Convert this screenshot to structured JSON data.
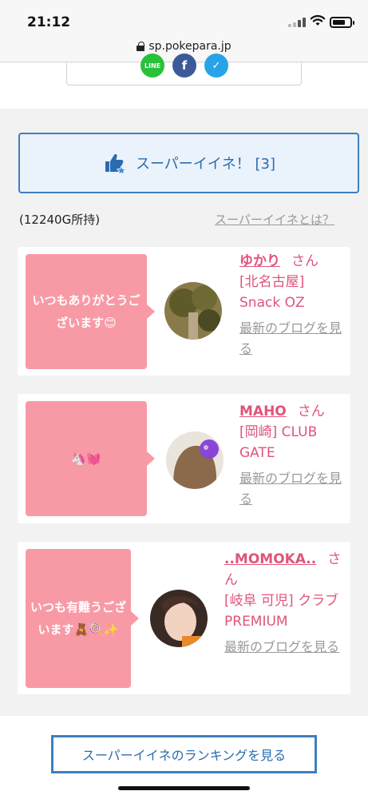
{
  "status": {
    "time": "21:12"
  },
  "browser": {
    "url": "sp.pokepara.jp"
  },
  "share": {
    "line_label": "LINE",
    "facebook_glyph": "f",
    "twitter_glyph": "✓"
  },
  "super_button": {
    "label": "スーパーイイネ！ [3]"
  },
  "gold": {
    "text": "(12240G所持)"
  },
  "what_link": {
    "text": "スーパーイイネとは？"
  },
  "cards": [
    {
      "message": "いつもありがとうございます😊",
      "name": "ゆかり",
      "suffix": "さん",
      "shop": "[北名古屋] Snack OZ",
      "blog": "最新のブログを見る"
    },
    {
      "message": "🦄💓",
      "name": "MAHO",
      "suffix": "さん",
      "shop": "[岡崎] CLUB GATE",
      "blog": "最新のブログを見る"
    },
    {
      "message": "いつも有難うございます🧸🍭✨",
      "name": "..MOMOKA..",
      "suffix": "さん",
      "shop": "[岐阜 可児] クラブ PREMIUM",
      "blog": "最新のブログを見る"
    }
  ],
  "ranking": {
    "label": "スーパーイイネのランキングを見る"
  },
  "colors": {
    "accent_blue": "#3e7fbd",
    "pink": "#f89aa6",
    "name_pink": "#e0547a"
  }
}
